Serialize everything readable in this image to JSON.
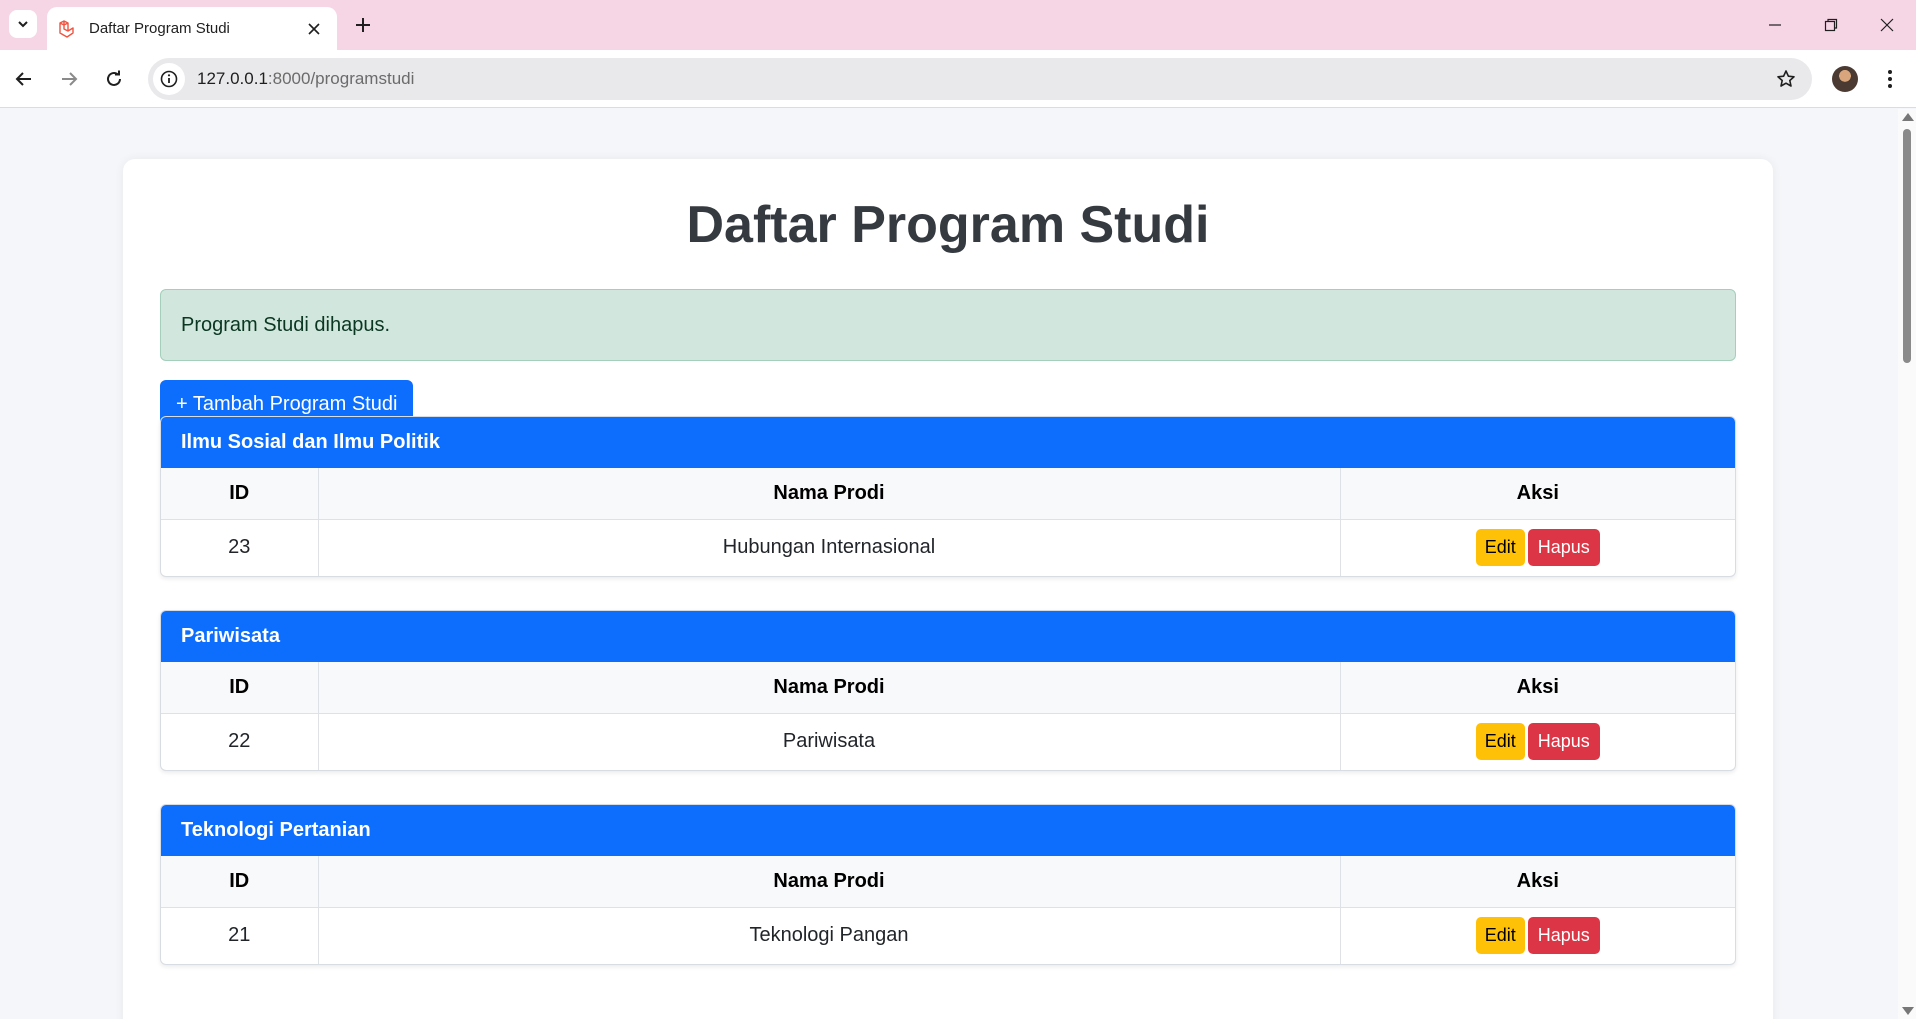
{
  "browser": {
    "tab_title": "Daftar Program Studi",
    "url_host": "127.0.0.1",
    "url_path": ":8000/programstudi",
    "tabbar_color": "#f6d5e5"
  },
  "page": {
    "title": "Daftar Program Studi",
    "alert": "Program Studi dihapus.",
    "add_button": "+ Tambah Program Studi",
    "accent": "#0d6efd"
  },
  "groups": [
    {
      "name": "Ilmu Sosial dan Ilmu Politik",
      "columns": [
        "ID",
        "Nama Prodi",
        "Aksi"
      ],
      "rows": [
        {
          "id": "23",
          "nama": "Hubungan Internasional",
          "edit": "Edit",
          "hapus": "Hapus"
        }
      ]
    },
    {
      "name": "Pariwisata",
      "columns": [
        "ID",
        "Nama Prodi",
        "Aksi"
      ],
      "rows": [
        {
          "id": "22",
          "nama": "Pariwisata",
          "edit": "Edit",
          "hapus": "Hapus"
        }
      ]
    },
    {
      "name": "Teknologi Pertanian",
      "columns": [
        "ID",
        "Nama Prodi",
        "Aksi"
      ],
      "rows": [
        {
          "id": "21",
          "nama": "Teknologi Pangan",
          "edit": "Edit",
          "hapus": "Hapus"
        }
      ]
    }
  ]
}
